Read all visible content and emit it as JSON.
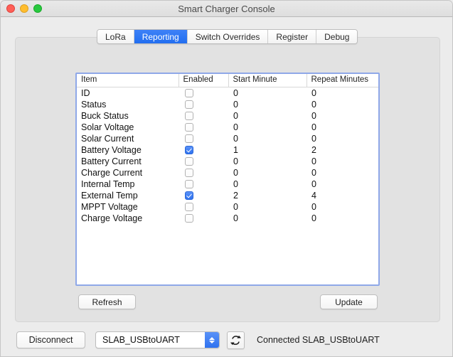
{
  "window": {
    "title": "Smart Charger Console",
    "traffic_lights": [
      "close",
      "minimize",
      "maximize"
    ]
  },
  "tabs": [
    {
      "label": "LoRa",
      "active": false
    },
    {
      "label": "Reporting",
      "active": true
    },
    {
      "label": "Switch Overrides",
      "active": false
    },
    {
      "label": "Register",
      "active": false
    },
    {
      "label": "Debug",
      "active": false
    }
  ],
  "table": {
    "columns": [
      "Item",
      "Enabled",
      "Start Minute",
      "Repeat Minutes"
    ],
    "rows": [
      {
        "item": "ID",
        "enabled": false,
        "start_minute": "0",
        "repeat_minutes": "0"
      },
      {
        "item": "Status",
        "enabled": false,
        "start_minute": "0",
        "repeat_minutes": "0"
      },
      {
        "item": "Buck Status",
        "enabled": false,
        "start_minute": "0",
        "repeat_minutes": "0"
      },
      {
        "item": "Solar Voltage",
        "enabled": false,
        "start_minute": "0",
        "repeat_minutes": "0"
      },
      {
        "item": "Solar Current",
        "enabled": false,
        "start_minute": "0",
        "repeat_minutes": "0"
      },
      {
        "item": "Battery Voltage",
        "enabled": true,
        "start_minute": "1",
        "repeat_minutes": "2"
      },
      {
        "item": "Battery Current",
        "enabled": false,
        "start_minute": "0",
        "repeat_minutes": "0"
      },
      {
        "item": "Charge Current",
        "enabled": false,
        "start_minute": "0",
        "repeat_minutes": "0"
      },
      {
        "item": "Internal Temp",
        "enabled": false,
        "start_minute": "0",
        "repeat_minutes": "0"
      },
      {
        "item": "External Temp",
        "enabled": true,
        "start_minute": "2",
        "repeat_minutes": "4"
      },
      {
        "item": "MPPT Voltage",
        "enabled": false,
        "start_minute": "0",
        "repeat_minutes": "0"
      },
      {
        "item": "Charge Voltage",
        "enabled": false,
        "start_minute": "0",
        "repeat_minutes": "0"
      }
    ]
  },
  "panel_buttons": {
    "refresh_label": "Refresh",
    "update_label": "Update"
  },
  "bottom_bar": {
    "disconnect_label": "Disconnect",
    "port_value": "SLAB_USBtoUART",
    "reload_icon": "refresh-circular-arrows-icon",
    "status": "Connected SLAB_USBtoUART"
  },
  "colors": {
    "accent_blue": "#2f72ef",
    "table_focus_ring": "#8fa8e8",
    "window_bg": "#ececec",
    "panel_bg": "#e2e2e2",
    "traffic_close": "#ff5f57",
    "traffic_min": "#ffbd2e",
    "traffic_max": "#28c840"
  }
}
